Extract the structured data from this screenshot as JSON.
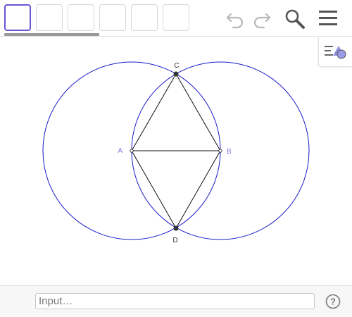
{
  "toolbar": {
    "tools": [
      {
        "icon": "tool-slot-1",
        "selected": true
      },
      {
        "icon": "tool-slot-2",
        "selected": false
      },
      {
        "icon": "tool-slot-3",
        "selected": false
      },
      {
        "icon": "tool-slot-4",
        "selected": false
      },
      {
        "icon": "tool-slot-5",
        "selected": false
      },
      {
        "icon": "tool-slot-6",
        "selected": false
      }
    ],
    "actions": [
      "undo-icon",
      "redo-icon",
      "search-icon",
      "menu-icon"
    ]
  },
  "construction": {
    "points": {
      "A": {
        "label": "A",
        "color": "#7a7ae0"
      },
      "B": {
        "label": "B",
        "color": "#7a7ae0"
      },
      "C": {
        "label": "C",
        "color": "#333333"
      },
      "D": {
        "label": "D",
        "color": "#333333"
      }
    },
    "circle_color": "#1a1acc",
    "segment_color": "#111111"
  },
  "input_bar": {
    "placeholder": "Input…",
    "value": ""
  },
  "colors": {
    "selection": "#6557d2",
    "icon": "#555555",
    "disabled_icon": "#b8b8b8"
  }
}
